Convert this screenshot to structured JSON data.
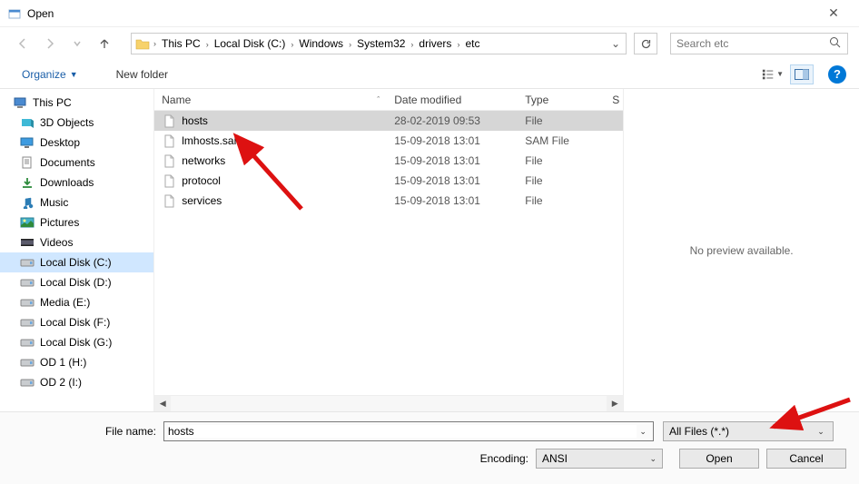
{
  "title": "Open",
  "breadcrumbs": [
    "This PC",
    "Local Disk (C:)",
    "Windows",
    "System32",
    "drivers",
    "etc"
  ],
  "search_placeholder": "Search etc",
  "toolbar": {
    "organize": "Organize",
    "new_folder": "New folder"
  },
  "tree": {
    "root": "This PC",
    "items": [
      {
        "label": "3D Objects"
      },
      {
        "label": "Desktop"
      },
      {
        "label": "Documents"
      },
      {
        "label": "Downloads"
      },
      {
        "label": "Music"
      },
      {
        "label": "Pictures"
      },
      {
        "label": "Videos"
      },
      {
        "label": "Local Disk (C:)",
        "selected": true
      },
      {
        "label": "Local Disk (D:)"
      },
      {
        "label": "Media (E:)"
      },
      {
        "label": "Local Disk (F:)"
      },
      {
        "label": "Local Disk (G:)"
      },
      {
        "label": "OD 1 (H:)"
      },
      {
        "label": "OD 2 (I:)"
      }
    ]
  },
  "columns": {
    "name": "Name",
    "date": "Date modified",
    "type": "Type",
    "size": "S"
  },
  "files": [
    {
      "name": "hosts",
      "date": "28-02-2019 09:53",
      "type": "File",
      "selected": true
    },
    {
      "name": "lmhosts.sam",
      "date": "15-09-2018 13:01",
      "type": "SAM File"
    },
    {
      "name": "networks",
      "date": "15-09-2018 13:01",
      "type": "File"
    },
    {
      "name": "protocol",
      "date": "15-09-2018 13:01",
      "type": "File"
    },
    {
      "name": "services",
      "date": "15-09-2018 13:01",
      "type": "File"
    }
  ],
  "preview_message": "No preview available.",
  "bottom": {
    "filename_label": "File name:",
    "filename_value": "hosts",
    "filter": "All Files  (*.*)",
    "encoding_label": "Encoding:",
    "encoding_value": "ANSI",
    "open": "Open",
    "cancel": "Cancel"
  }
}
